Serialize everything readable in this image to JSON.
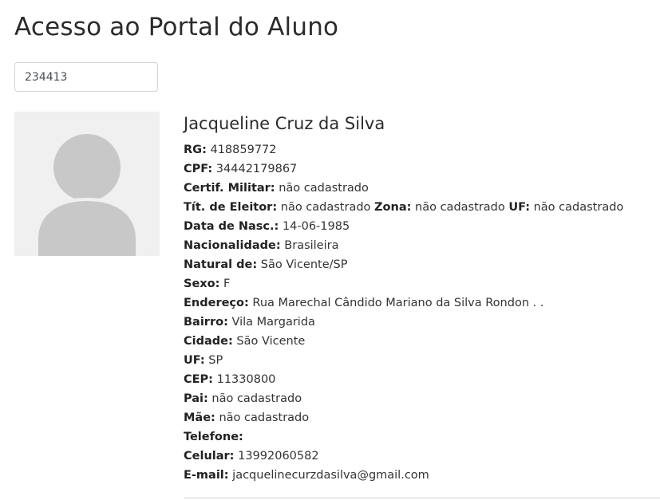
{
  "page": {
    "title": "Acesso ao Portal do Aluno"
  },
  "search": {
    "value": "234413"
  },
  "student": {
    "name": "Jacqueline Cruz da Silva",
    "rg": {
      "label": "RG:",
      "value": "418859772"
    },
    "cpf": {
      "label": "CPF:",
      "value": "34442179867"
    },
    "certif_militar": {
      "label": "Certif. Militar:",
      "value": "não cadastrado"
    },
    "titulo_eleitor": {
      "label": "Tít. de Eleitor:",
      "value": "não cadastrado",
      "zona_label": "Zona:",
      "zona_value": "não cadastrado",
      "uf_label": "UF:",
      "uf_value": "não cadastrado"
    },
    "data_nasc": {
      "label": "Data de Nasc.:",
      "value": "14-06-1985"
    },
    "nacionalidade": {
      "label": "Nacionalidade:",
      "value": "Brasileira"
    },
    "natural_de": {
      "label": "Natural de:",
      "value": "São Vicente/SP"
    },
    "sexo": {
      "label": "Sexo:",
      "value": "F"
    },
    "endereco": {
      "label": "Endereço:",
      "value": "Rua Marechal Cândido Mariano da Silva Rondon . ."
    },
    "bairro": {
      "label": "Bairro:",
      "value": "Vila Margarida"
    },
    "cidade": {
      "label": "Cidade:",
      "value": "São Vicente"
    },
    "uf": {
      "label": "UF:",
      "value": "SP"
    },
    "cep": {
      "label": "CEP:",
      "value": "11330800"
    },
    "pai": {
      "label": "Pai:",
      "value": "não cadastrado"
    },
    "mae": {
      "label": "Mãe:",
      "value": "não cadastrado"
    },
    "telefone": {
      "label": "Telefone:",
      "value": ""
    },
    "celular": {
      "label": "Celular:",
      "value": "13992060582"
    },
    "email": {
      "label": "E-mail:",
      "value": "jacquelinecurzdasilva@gmail.com"
    }
  },
  "icons": {
    "avatar": "user-silhouette-icon"
  },
  "colors": {
    "avatar_background": "#f0f0f0",
    "avatar_figure": "#c8c8c8"
  }
}
